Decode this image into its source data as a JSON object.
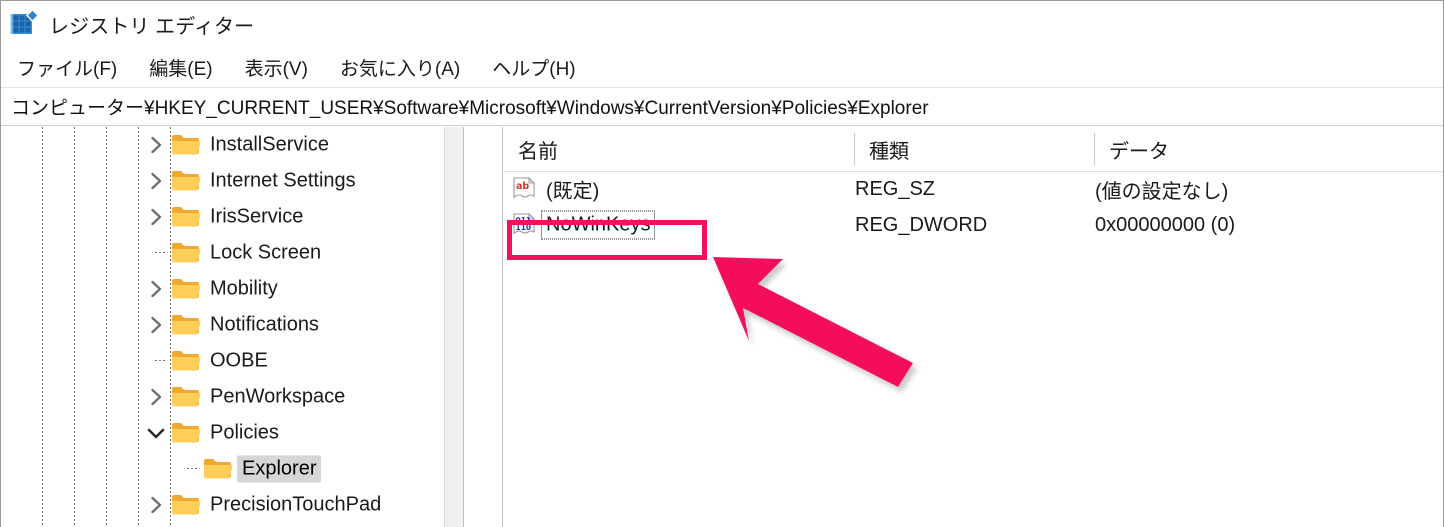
{
  "window": {
    "title": "レジストリ エディター",
    "icon": "registry-editor-icon"
  },
  "menu": {
    "items": [
      {
        "label": "ファイル(F)",
        "name": "menu-file"
      },
      {
        "label": "編集(E)",
        "name": "menu-edit"
      },
      {
        "label": "表示(V)",
        "name": "menu-view"
      },
      {
        "label": "お気に入り(A)",
        "name": "menu-favorites"
      },
      {
        "label": "ヘルプ(H)",
        "name": "menu-help"
      }
    ]
  },
  "address": {
    "path": "コンピューター¥HKEY_CURRENT_USER¥Software¥Microsoft¥Windows¥CurrentVersion¥Policies¥Explorer"
  },
  "tree": {
    "nodes": [
      {
        "label": "InstallService",
        "indent": 5,
        "expander": "collapsed",
        "selected": false
      },
      {
        "label": "Internet Settings",
        "indent": 5,
        "expander": "collapsed",
        "selected": false
      },
      {
        "label": "IrisService",
        "indent": 5,
        "expander": "collapsed",
        "selected": false
      },
      {
        "label": "Lock Screen",
        "indent": 5,
        "expander": "leaf",
        "selected": false
      },
      {
        "label": "Mobility",
        "indent": 5,
        "expander": "collapsed",
        "selected": false
      },
      {
        "label": "Notifications",
        "indent": 5,
        "expander": "collapsed",
        "selected": false
      },
      {
        "label": "OOBE",
        "indent": 5,
        "expander": "leaf",
        "selected": false
      },
      {
        "label": "PenWorkspace",
        "indent": 5,
        "expander": "collapsed",
        "selected": false
      },
      {
        "label": "Policies",
        "indent": 5,
        "expander": "expanded",
        "selected": false
      },
      {
        "label": "Explorer",
        "indent": 6,
        "expander": "leaf",
        "selected": true
      },
      {
        "label": "PrecisionTouchPad",
        "indent": 5,
        "expander": "collapsed",
        "selected": false
      }
    ]
  },
  "list": {
    "columns": [
      {
        "label": "名前",
        "name": "column-name"
      },
      {
        "label": "種類",
        "name": "column-type"
      },
      {
        "label": "データ",
        "name": "column-data"
      }
    ],
    "rows": [
      {
        "name": "(既定)",
        "type": "REG_SZ",
        "data": "(値の設定なし)",
        "icon": "reg-sz-icon",
        "focused": false,
        "highlighted": false
      },
      {
        "name": "NoWinKeys",
        "type": "REG_DWORD",
        "data": "0x00000000 (0)",
        "icon": "reg-dword-icon",
        "focused": true,
        "highlighted": true
      }
    ]
  },
  "annotation": {
    "color": "#f4115c",
    "box_target": "NoWinKeys",
    "arrow": "pointer-arrow"
  },
  "colors": {
    "accent_pink": "#f4115c",
    "folder_yellow": "#ffc83d",
    "selection_gray": "#d6d6d6",
    "text": "#1a1a1a"
  }
}
